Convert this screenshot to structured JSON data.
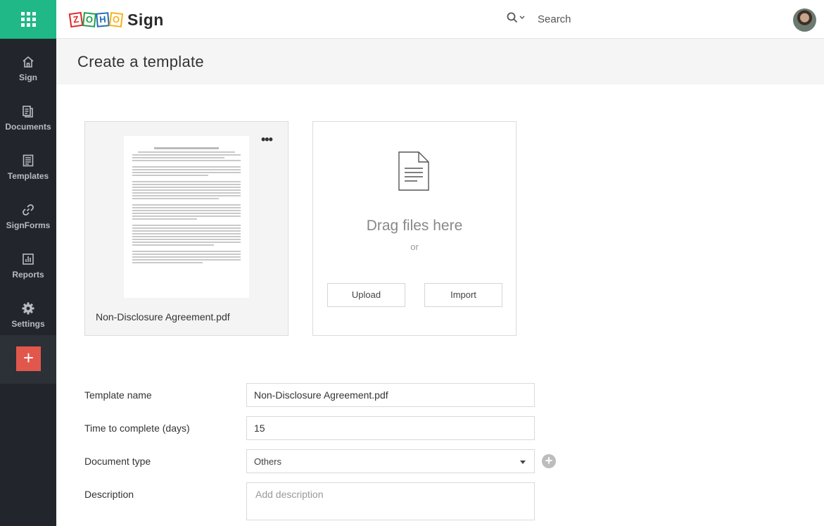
{
  "brand": {
    "logo_letters": [
      "Z",
      "O",
      "H",
      "O"
    ],
    "logo_colors": [
      "#e42527",
      "#1f9f4b",
      "#226db4",
      "#f9b21d"
    ],
    "product": "Sign",
    "accent": "#1fb886",
    "nav_bg": "#22262c",
    "add_button_color": "#e2574c"
  },
  "nav": {
    "apps_icon": "apps-grid-icon",
    "items": [
      {
        "label": "Sign",
        "icon": "home-icon"
      },
      {
        "label": "Documents",
        "icon": "documents-icon"
      },
      {
        "label": "Templates",
        "icon": "templates-icon"
      },
      {
        "label": "SignForms",
        "icon": "link-icon"
      },
      {
        "label": "Reports",
        "icon": "reports-icon"
      },
      {
        "label": "Settings",
        "icon": "gear-icon"
      }
    ],
    "add_label": "+"
  },
  "search": {
    "placeholder": "Search",
    "icon": "search-icon"
  },
  "page": {
    "title": "Create a template"
  },
  "document": {
    "file_name": "Non-Disclosure Agreement.pdf",
    "more_label": "•••"
  },
  "upload": {
    "drag_text": "Drag files here",
    "or_text": "or",
    "upload_label": "Upload",
    "import_label": "Import"
  },
  "form": {
    "template_name_label": "Template name",
    "template_name_value": "Non-Disclosure Agreement.pdf",
    "time_label": "Time to complete (days)",
    "time_value": "15",
    "doc_type_label": "Document type",
    "doc_type_value": "Others",
    "description_label": "Description",
    "description_placeholder": "Add description"
  }
}
